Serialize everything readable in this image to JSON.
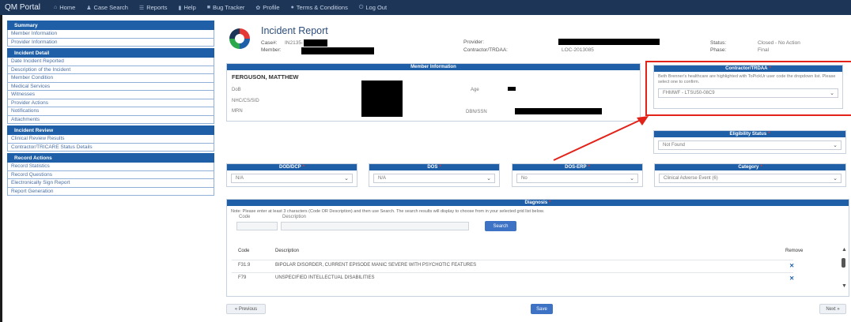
{
  "app": {
    "title": "QM Portal"
  },
  "topnav": [
    {
      "label": "Home",
      "icon": "home-icon",
      "glyph": "⌂"
    },
    {
      "label": "Case Search",
      "icon": "user-icon",
      "glyph": "♟"
    },
    {
      "label": "Reports",
      "icon": "list-icon",
      "glyph": "☰"
    },
    {
      "label": "Help",
      "icon": "book-icon",
      "glyph": "▮"
    },
    {
      "label": "Bug Tracker",
      "icon": "bug-icon",
      "glyph": "■"
    },
    {
      "label": "Profile",
      "icon": "gear-icon",
      "glyph": "✿"
    },
    {
      "label": "Terms & Conditions",
      "icon": "info-icon",
      "glyph": "●"
    },
    {
      "label": "Log Out",
      "icon": "logout-icon",
      "glyph": "⏻"
    }
  ],
  "sidebar": {
    "sections": [
      {
        "header": "Summary",
        "items": [
          "Member Information",
          "Provider Information"
        ]
      },
      {
        "header": "Incident Detail",
        "items": [
          "Date Incident Reported",
          "Description of the Incident",
          "Member Condition",
          "Medical Services",
          "Witnesses",
          "Provider Actions",
          "Notifications",
          "Attachments"
        ]
      },
      {
        "header": "Incident Review",
        "items": [
          "Clinical Review Results",
          "Contractor/TRICARE Status Details"
        ]
      },
      {
        "header": "Record Actions",
        "items": [
          "Record Statistics",
          "Record Questions",
          "Electronically Sign Report",
          "Report Generation"
        ]
      }
    ]
  },
  "report": {
    "title": "Incident Report",
    "case_label": "Case#:",
    "case_value": "IN2135-",
    "member_label": "Member:",
    "provider_label": "Provider:",
    "contractor_label": "Contractor/TRDAA:",
    "contractor_value": "LOC-2013085",
    "status_label": "Status:",
    "status_value": "Closed - No Action",
    "phase_label": "Phase:",
    "phase_value": "Final"
  },
  "member_info": {
    "header": "Member Information",
    "name": "FERGUSON, MATTHEW",
    "fields": [
      "DoB",
      "NHC/CS/SID",
      "MRN"
    ],
    "age_label": "Age",
    "ssn_label": "DBN/SSN"
  },
  "contractor_tricare": {
    "header": "Contractor/TRDAA",
    "note": "Beth Brenner's healthcare are highlighted with ToPickUr user code the dropdown list. Please select one to confirm.",
    "selected": "FHMWF - LTSU50-08C9"
  },
  "eligibility": {
    "header": "Eligibility Status",
    "selected": "Not Found"
  },
  "dropdowns": [
    {
      "header": "DOD/DCP",
      "value": "N/A"
    },
    {
      "header": "DOS",
      "value": "N/A"
    },
    {
      "header": "DOS-ERP",
      "value": "No"
    },
    {
      "header": "Category",
      "value": "Clinical Adverse Event (6)"
    }
  ],
  "diagnosis": {
    "header": "Diagnosis",
    "note": "Note: Please enter at least 3 characters (Code OR Description) and then use Search. The search results will display to choose from in your selected grid list below.",
    "code_label": "Code",
    "desc_label": "Description",
    "search_button": "Search",
    "columns": [
      "Code",
      "Description",
      "Remove"
    ],
    "rows": [
      {
        "code": "F31.9",
        "description": "BIPOLAR DISORDER, CURRENT EPISODE MANIC SEVERE WITH PSYCHOTIC FEATURES"
      },
      {
        "code": "F79",
        "description": "UNSPECIFIED INTELLECTUAL DISABILITIES"
      }
    ]
  },
  "footer": {
    "previous": "« Previous",
    "save": "Save",
    "next": "Next »"
  }
}
